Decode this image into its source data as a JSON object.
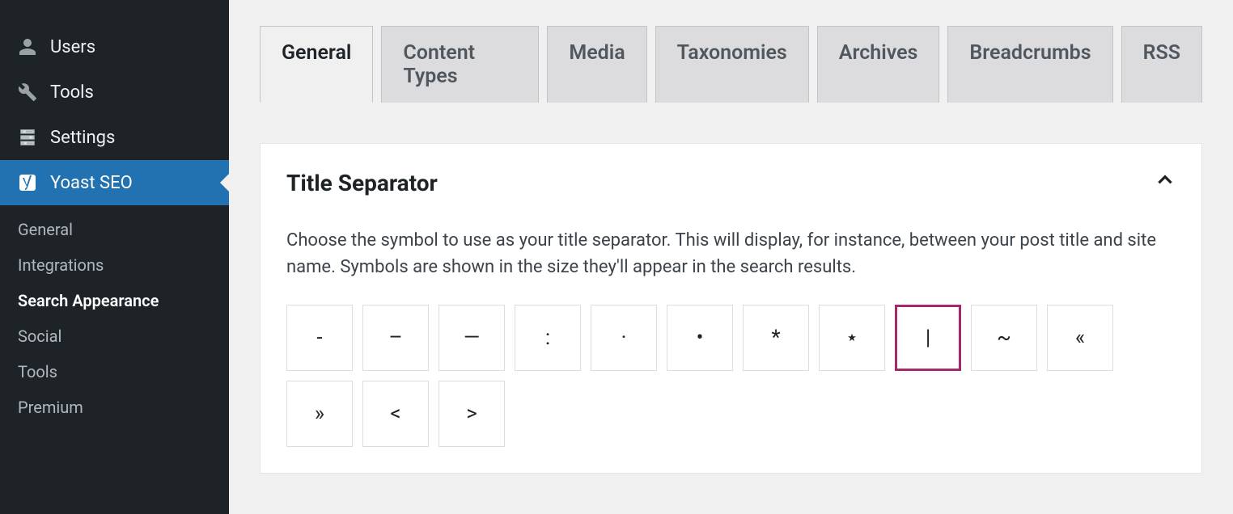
{
  "sidebar": {
    "items": [
      {
        "label": "Users",
        "icon": "user"
      },
      {
        "label": "Tools",
        "icon": "wrench"
      },
      {
        "label": "Settings",
        "icon": "sliders"
      },
      {
        "label": "Yoast SEO",
        "icon": "yoast",
        "active": true
      }
    ],
    "submenu": [
      {
        "label": "General"
      },
      {
        "label": "Integrations"
      },
      {
        "label": "Search Appearance",
        "current": true
      },
      {
        "label": "Social"
      },
      {
        "label": "Tools"
      },
      {
        "label": "Premium"
      }
    ]
  },
  "tabs": [
    {
      "label": "General",
      "active": true
    },
    {
      "label": "Content Types"
    },
    {
      "label": "Media"
    },
    {
      "label": "Taxonomies"
    },
    {
      "label": "Archives"
    },
    {
      "label": "Breadcrumbs"
    },
    {
      "label": "RSS"
    }
  ],
  "panel": {
    "title": "Title Separator",
    "description": "Choose the symbol to use as your title separator. This will display, for instance, between your post title and site name. Symbols are shown in the size they'll appear in the search results.",
    "separators": [
      {
        "symbol": "-",
        "name": "dash"
      },
      {
        "symbol": "–",
        "name": "ndash"
      },
      {
        "symbol": "—",
        "name": "mdash"
      },
      {
        "symbol": ":",
        "name": "colon"
      },
      {
        "symbol": "·",
        "name": "middot"
      },
      {
        "symbol": "•",
        "name": "bullet"
      },
      {
        "symbol": "*",
        "name": "asterisk"
      },
      {
        "symbol": "⋆",
        "name": "star"
      },
      {
        "symbol": "|",
        "name": "pipe",
        "selected": true
      },
      {
        "symbol": "~",
        "name": "tilde"
      },
      {
        "symbol": "«",
        "name": "laquo"
      },
      {
        "symbol": "»",
        "name": "raquo"
      },
      {
        "symbol": "<",
        "name": "lt"
      },
      {
        "symbol": ">",
        "name": "gt"
      }
    ]
  }
}
